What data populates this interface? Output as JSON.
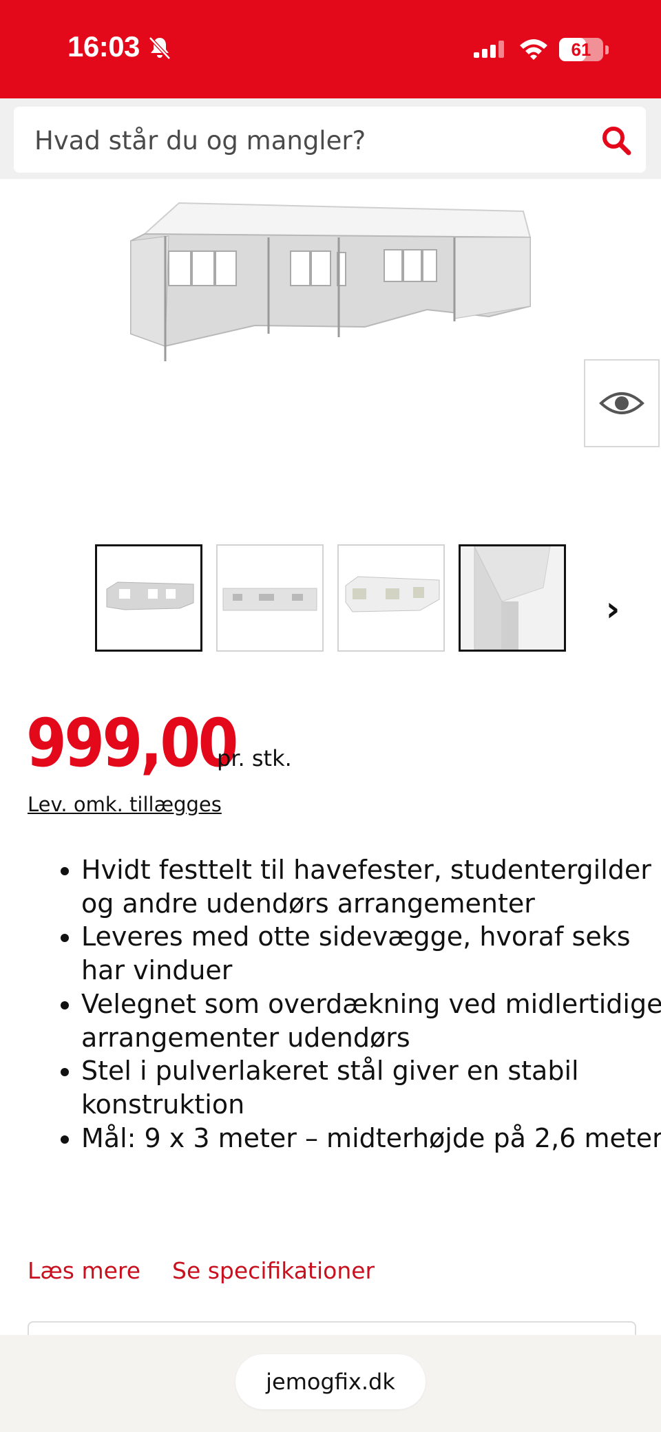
{
  "status": {
    "time": "16:03",
    "battery": "61",
    "battery_level": 0.61
  },
  "search": {
    "placeholder": "Hvad står du og mangler?"
  },
  "gallery": {
    "thumbnails": [
      "thumbnail-1",
      "thumbnail-2",
      "thumbnail-3",
      "thumbnail-4"
    ],
    "next_label": "›"
  },
  "price": {
    "amount": "999,00",
    "unit": "pr. stk.",
    "delivery_note": "Lev. omk. tillægges"
  },
  "features": [
    "Hvidt festtelt til havefester, studentergilder og andre udendørs arrangementer",
    "Leveres med otte sidevægge, hvoraf seks har vinduer",
    "Velegnet som overdækning ved midlertidige arrangementer udendørs",
    "Stel i pulverlakeret stål giver en stabil konstruktion",
    "Mål: 9 x 3 meter – midterhøjde på 2,6 meter"
  ],
  "links": {
    "read_more": "Læs mere",
    "specs": "Se specifikationer"
  },
  "browser": {
    "url": "jemogfix.dk"
  },
  "colors": {
    "brand": "#e3091b",
    "link": "#c8101e"
  }
}
